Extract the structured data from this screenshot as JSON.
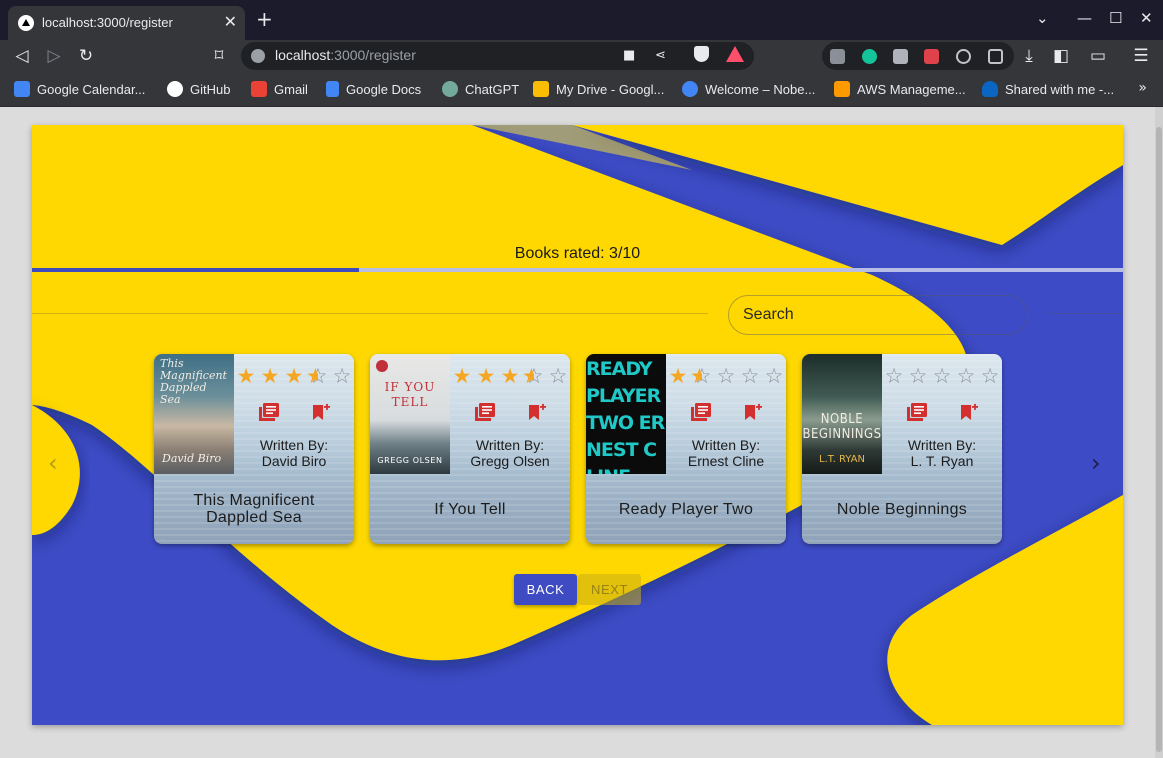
{
  "browser": {
    "tab_title": "localhost:3000/register",
    "url_host": "localhost",
    "url_path": ":3000/register",
    "bookmarks": [
      {
        "label": "Google Calendar...",
        "icon": "calendar-icon",
        "color": "#4285f4"
      },
      {
        "label": "GitHub",
        "icon": "github-icon",
        "color": "#ffffff"
      },
      {
        "label": "Gmail",
        "icon": "gmail-icon",
        "color": "#ea4335"
      },
      {
        "label": "Google Docs",
        "icon": "docs-icon",
        "color": "#4285f4"
      },
      {
        "label": "ChatGPT",
        "icon": "chatgpt-icon",
        "color": "#74aa9c"
      },
      {
        "label": "My Drive - Googl...",
        "icon": "drive-icon",
        "color": "#fbbc04"
      },
      {
        "label": "Welcome – Nobe...",
        "icon": "cloud-icon",
        "color": "#4285f4"
      },
      {
        "label": "AWS Manageme...",
        "icon": "aws-icon",
        "color": "#ff9900"
      },
      {
        "label": "Shared with me -...",
        "icon": "onedrive-icon",
        "color": "#0a66c2"
      }
    ]
  },
  "register": {
    "rated_text": "Books rated: 3/10",
    "rated_count": 3,
    "rated_total": 10,
    "search_placeholder": "Search",
    "back_label": "BACK",
    "next_label": "NEXT",
    "accent_color": "#3f4bc2",
    "background_yellow": "#fed800"
  },
  "books": [
    {
      "title": "This Magnificent Dappled Sea",
      "author": "Written By:\nDavid Biro",
      "author_name": "David Biro",
      "rating": 3.5,
      "cover_text": "This Magnificent Dappled Sea",
      "cover_author": "David Biro"
    },
    {
      "title": "If You Tell",
      "author": "Written By:\nGregg Olsen",
      "author_name": "Gregg Olsen",
      "rating": 3.5,
      "cover_text": "IF YOU TELL",
      "cover_author": "GREGG OLSEN"
    },
    {
      "title": "Ready Player Two",
      "author": "Written By:\nErnest Cline",
      "author_name": "Ernest Cline",
      "rating": 1.5,
      "cover_text": "READY PLAYER TWO ERNEST CLINE",
      "cover_author": "ERNEST CLINE"
    },
    {
      "title": "Noble Beginnings",
      "author": "Written By:\nL. T. Ryan",
      "author_name": "L. T. Ryan",
      "rating": 0,
      "cover_text": "NOBLE BEGINNINGS",
      "cover_author": "L.T. RYAN"
    }
  ]
}
